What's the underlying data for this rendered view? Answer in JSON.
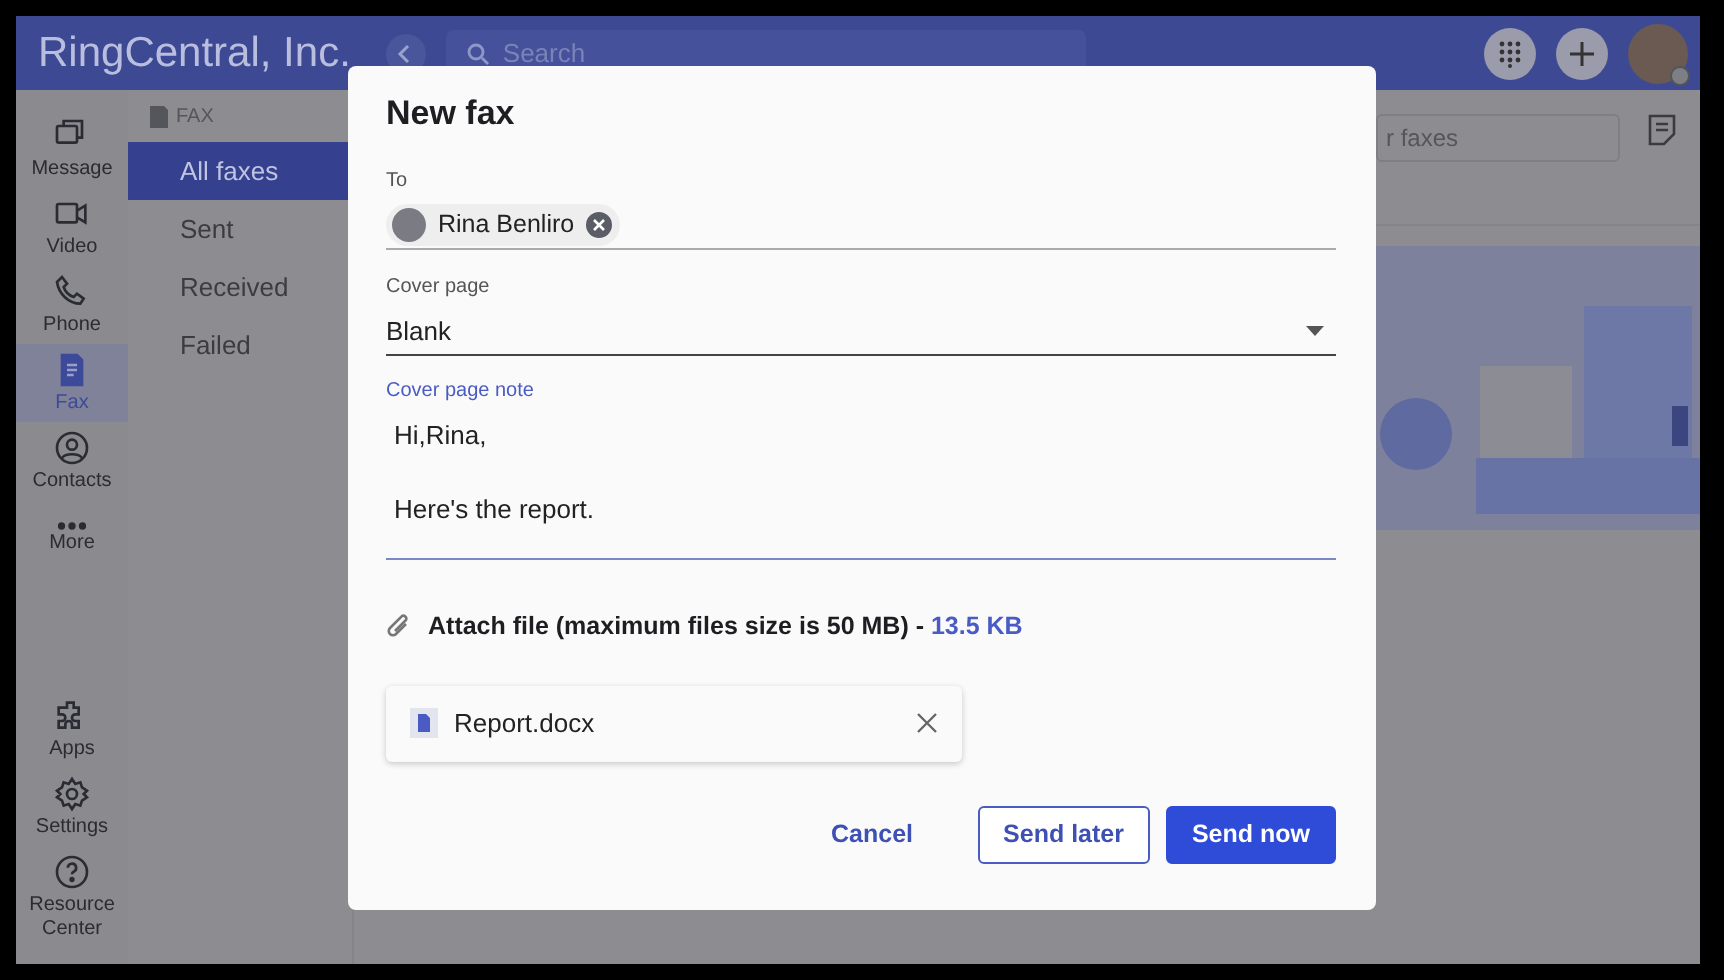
{
  "header": {
    "title": "RingCentral, Inc.",
    "search_placeholder": "Search"
  },
  "rail": {
    "items": [
      {
        "label": "Message",
        "selected": false
      },
      {
        "label": "Video",
        "selected": false
      },
      {
        "label": "Phone",
        "selected": false
      },
      {
        "label": "Fax",
        "selected": true
      },
      {
        "label": "Contacts",
        "selected": false
      },
      {
        "label": "More",
        "selected": false
      }
    ],
    "bottom_items": [
      {
        "label": "Apps"
      },
      {
        "label": "Settings"
      },
      {
        "label": "Resource Center"
      }
    ]
  },
  "fax_nav": {
    "heading": "FAX",
    "items": [
      {
        "label": "All faxes",
        "selected": true
      },
      {
        "label": "Sent",
        "selected": false
      },
      {
        "label": "Received",
        "selected": false
      },
      {
        "label": "Failed",
        "selected": false
      }
    ]
  },
  "main": {
    "filter_placeholder": "r faxes"
  },
  "dialog": {
    "title": "New fax",
    "to_label": "To",
    "recipients": [
      {
        "name": "Rina Benliro"
      }
    ],
    "cover_page": {
      "label": "Cover page",
      "value": "Blank"
    },
    "note": {
      "label": "Cover page note",
      "value": "Hi,Rina,\n\nHere's the report."
    },
    "attach": {
      "label": "Attach file (maximum files size is 50 MB) -",
      "size": "13.5 KB"
    },
    "files": [
      {
        "name": "Report.docx"
      }
    ],
    "buttons": [
      {
        "label": "Cancel",
        "kind": "text"
      },
      {
        "label": "Send later",
        "kind": "outline"
      },
      {
        "label": "Send now",
        "kind": "primary"
      }
    ]
  }
}
